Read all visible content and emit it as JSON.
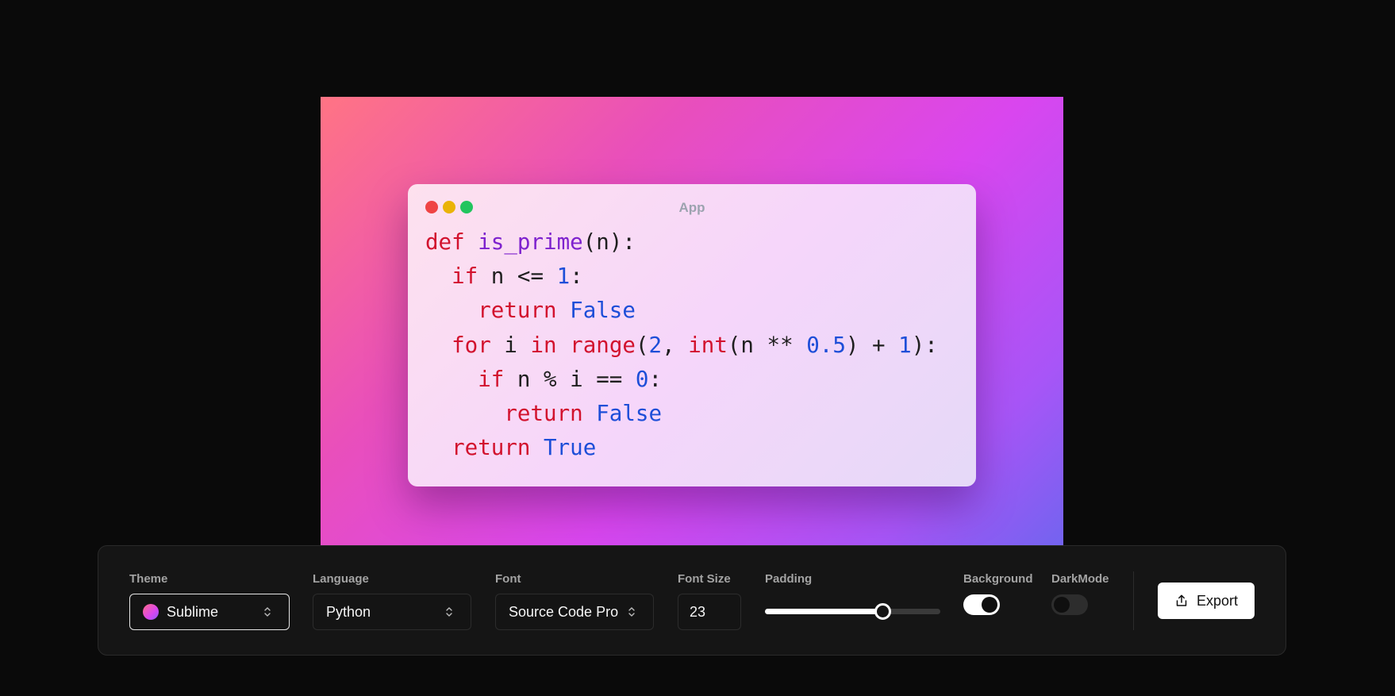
{
  "window": {
    "title": "App"
  },
  "code": {
    "lines": [
      [
        [
          "kw",
          "def "
        ],
        [
          "fn",
          "is_prime"
        ],
        [
          "plain",
          "(n):"
        ]
      ],
      [
        [
          "plain",
          "  "
        ],
        [
          "kw",
          "if "
        ],
        [
          "plain",
          "n <= "
        ],
        [
          "num",
          "1"
        ],
        [
          "plain",
          ":"
        ]
      ],
      [
        [
          "plain",
          "    "
        ],
        [
          "kw",
          "return "
        ],
        [
          "const",
          "False"
        ]
      ],
      [
        [
          "plain",
          "  "
        ],
        [
          "kw",
          "for "
        ],
        [
          "plain",
          "i "
        ],
        [
          "kw",
          "in "
        ],
        [
          "bi",
          "range"
        ],
        [
          "plain",
          "("
        ],
        [
          "num",
          "2"
        ],
        [
          "plain",
          ", "
        ],
        [
          "bi",
          "int"
        ],
        [
          "plain",
          "(n ** "
        ],
        [
          "num",
          "0.5"
        ],
        [
          "plain",
          ") + "
        ],
        [
          "num",
          "1"
        ],
        [
          "plain",
          "):"
        ]
      ],
      [
        [
          "plain",
          "    "
        ],
        [
          "kw",
          "if "
        ],
        [
          "plain",
          "n % i == "
        ],
        [
          "num",
          "0"
        ],
        [
          "plain",
          ":"
        ]
      ],
      [
        [
          "plain",
          "      "
        ],
        [
          "kw",
          "return "
        ],
        [
          "const",
          "False"
        ]
      ],
      [
        [
          "plain",
          "  "
        ],
        [
          "kw",
          "return "
        ],
        [
          "const",
          "True"
        ]
      ]
    ]
  },
  "toolbar": {
    "theme": {
      "label": "Theme",
      "value": "Sublime"
    },
    "language": {
      "label": "Language",
      "value": "Python"
    },
    "font": {
      "label": "Font",
      "value": "Source Code Pro"
    },
    "font_size": {
      "label": "Font Size",
      "value": "23"
    },
    "padding": {
      "label": "Padding",
      "level": 0.67
    },
    "background": {
      "label": "Background",
      "on": true
    },
    "dark_mode": {
      "label": "DarkMode",
      "on": false
    },
    "export": {
      "label": "Export"
    }
  },
  "colors": {
    "keyword": "#d2122e",
    "function": "#7e22ce",
    "number": "#1d4ed8",
    "gradient_start": "#ff7484",
    "gradient_mid": "#d946ef",
    "gradient_end": "#6a66ee"
  },
  "icons": {
    "chevron": "chevron-up-down-icon",
    "export": "share-export-icon"
  }
}
